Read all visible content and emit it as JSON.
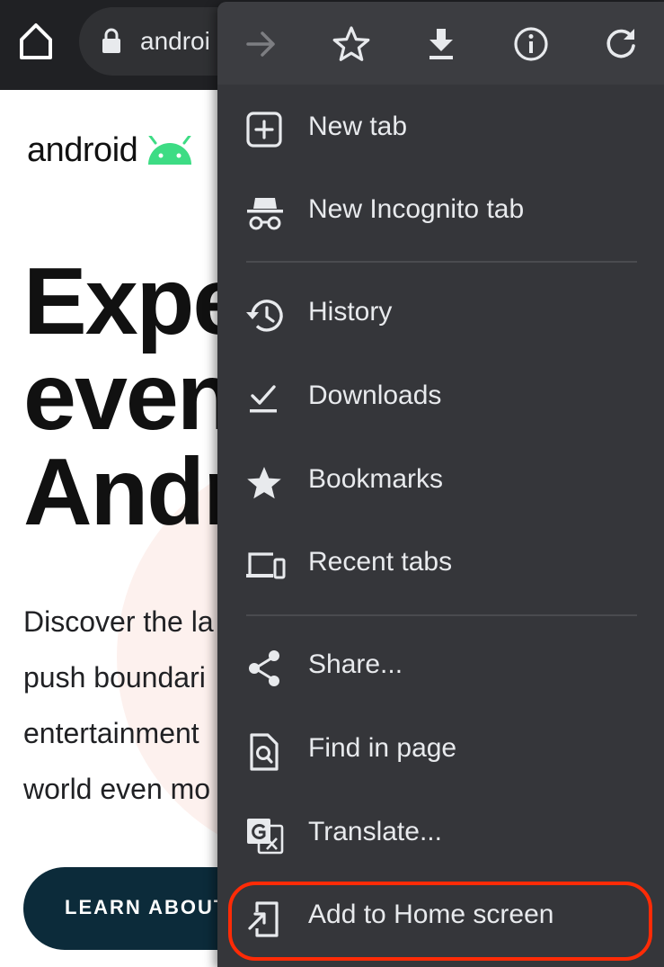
{
  "browser": {
    "omnibox_text": "androi"
  },
  "page": {
    "logo_text": "android",
    "headline_lines": [
      "Expe",
      "even",
      "Andr"
    ],
    "description_lines": [
      "Discover the la",
      "push boundari",
      "entertainment",
      "world even mo"
    ],
    "cta_label": "LEARN ABOUT"
  },
  "menu": {
    "action_icons": [
      "forward-icon",
      "bookmark-star-icon",
      "download-icon",
      "info-icon",
      "refresh-icon"
    ],
    "items": [
      {
        "label": "New tab",
        "icon": "new-tab-icon"
      },
      {
        "label": "New Incognito tab",
        "icon": "incognito-icon"
      },
      {
        "label": "History",
        "icon": "history-icon"
      },
      {
        "label": "Downloads",
        "icon": "downloads-icon"
      },
      {
        "label": "Bookmarks",
        "icon": "star-icon"
      },
      {
        "label": "Recent tabs",
        "icon": "devices-icon"
      },
      {
        "label": "Share...",
        "icon": "share-icon"
      },
      {
        "label": "Find in page",
        "icon": "find-in-page-icon"
      },
      {
        "label": "Translate...",
        "icon": "translate-icon"
      },
      {
        "label": "Add to Home screen",
        "icon": "add-to-home-icon"
      }
    ],
    "highlighted_item": "Add to Home screen"
  },
  "colors": {
    "menu_background": "#35363a",
    "toolbar_background": "#202124",
    "highlight_border": "#ff2b06",
    "android_green": "#3ddc84",
    "cta_background": "#0c2b3a"
  }
}
